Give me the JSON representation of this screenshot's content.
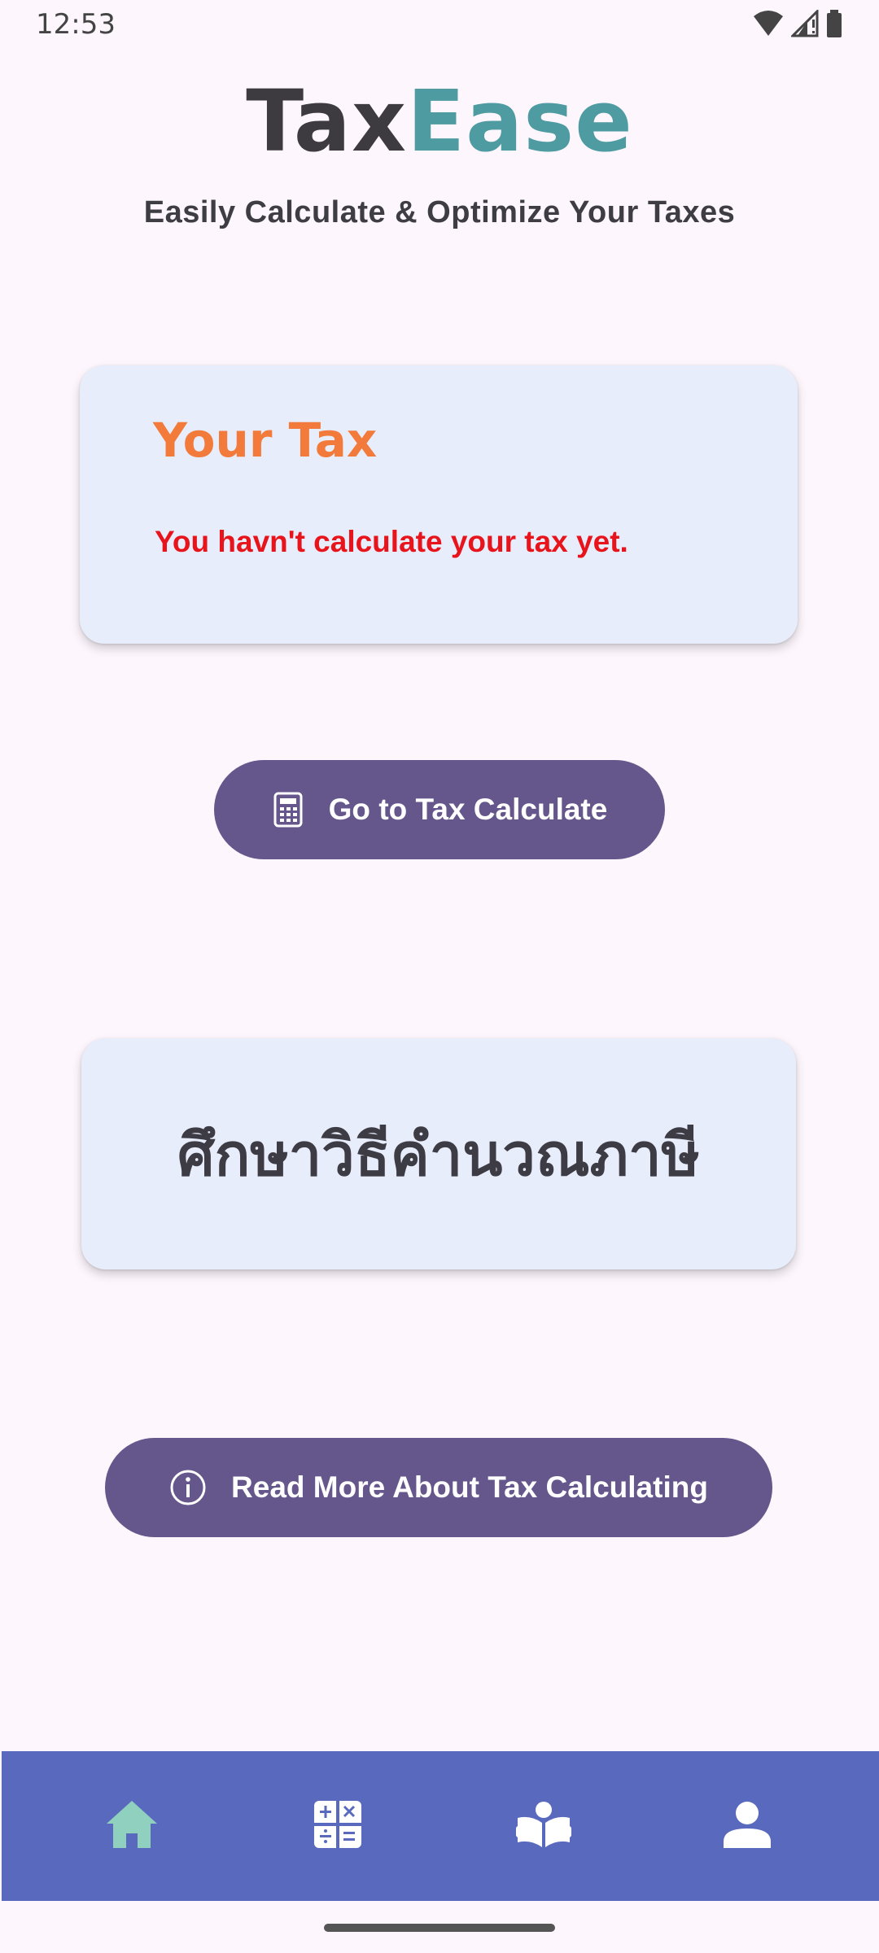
{
  "status_bar": {
    "time": "12:53",
    "icons": [
      "wifi-icon",
      "signal-icon",
      "battery-icon"
    ]
  },
  "header": {
    "title_part_a": "Tax",
    "title_part_b": "Ease",
    "subtitle": "Easily Calculate & Optimize Your Taxes"
  },
  "tax_card": {
    "title": "Your Tax",
    "message": "You havn't calculate your tax yet."
  },
  "calc_button": {
    "label": "Go to Tax Calculate",
    "icon": "calculator-icon"
  },
  "learn_card": {
    "title": "ศึกษาวิธีคำนวณภาษี"
  },
  "read_more_button": {
    "label": "Read More About Tax Calculating",
    "icon": "info-icon"
  },
  "bottom_nav": {
    "items": [
      {
        "icon": "home-icon",
        "active": true
      },
      {
        "icon": "calculator-grid-icon",
        "active": false
      },
      {
        "icon": "reader-book-icon",
        "active": false
      },
      {
        "icon": "profile-icon",
        "active": false
      }
    ]
  },
  "colors": {
    "background": "#fdf7fd",
    "card": "#e8edfb",
    "button": "#65568c",
    "nav": "#5969bd",
    "nav_active_icon": "#8fd0bf",
    "title_accent": "#4e9ba2",
    "tax_title": "#f27a3a",
    "warning": "#e8141c"
  }
}
